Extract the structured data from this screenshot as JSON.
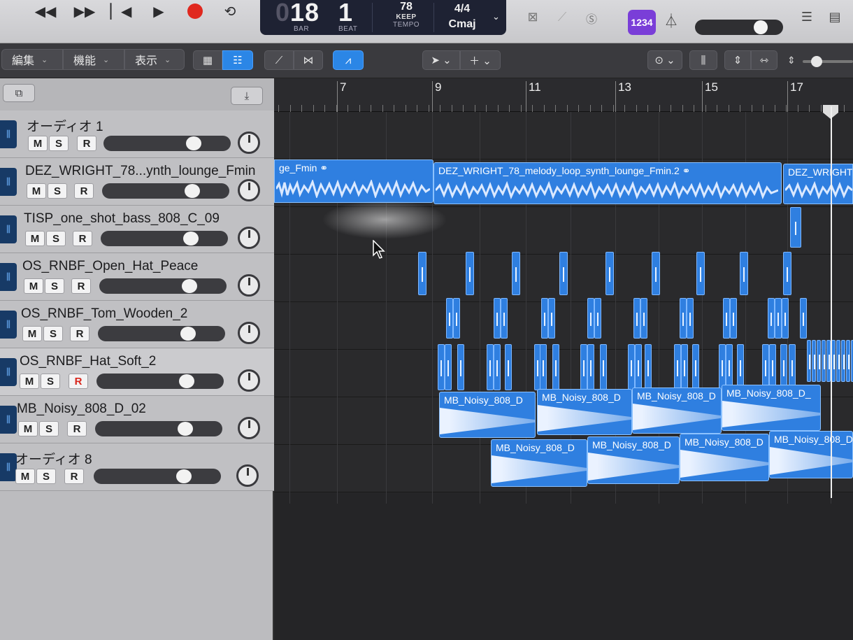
{
  "transport": {
    "lcd": {
      "bar_value": "18",
      "bar_label": "BAR",
      "bar_prefix": "0",
      "beat_value": "1",
      "beat_label": "BEAT",
      "tempo_value": "78",
      "tempo_mode": "KEEP",
      "tempo_label": "TEMPO",
      "time_signature": "4/4",
      "key": "Cmaj"
    },
    "count_in": "1234"
  },
  "toolbar": {
    "edit": "編集",
    "functions": "機能",
    "view": "表示"
  },
  "ruler": {
    "bars": [
      "7",
      "9",
      "11",
      "13",
      "15",
      "17"
    ]
  },
  "tracks": [
    {
      "name": "オーディオ 1",
      "mute": "M",
      "solo": "S",
      "rec": "R"
    },
    {
      "name": "DEZ_WRIGHT_78...ynth_lounge_Fmin",
      "mute": "M",
      "solo": "S",
      "rec": "R"
    },
    {
      "name": "TISP_one_shot_bass_808_C_09",
      "mute": "M",
      "solo": "S",
      "rec": "R"
    },
    {
      "name": "OS_RNBF_Open_Hat_Peace",
      "mute": "M",
      "solo": "S",
      "rec": "R"
    },
    {
      "name": "OS_RNBF_Tom_Wooden_2",
      "mute": "M",
      "solo": "S",
      "rec": "R"
    },
    {
      "name": "OS_RNBF_Hat_Soft_2",
      "mute": "M",
      "solo": "S",
      "rec": "R"
    },
    {
      "name": "MB_Noisy_808_D_02",
      "mute": "M",
      "solo": "S",
      "rec": "R"
    },
    {
      "name": "オーディオ 8",
      "mute": "M",
      "solo": "S",
      "rec": "R"
    }
  ],
  "regions": {
    "melody_a": "ge_Fmin",
    "melody_b": "DEZ_WRIGHT_78_melody_loop_synth_lounge_Fmin.2",
    "melody_c": "DEZ_WRIGHT",
    "noisy": [
      "MB_Noisy_808_D",
      "MB_Noisy_808_D",
      "MB_Noisy_808_D",
      "MB_Noisy_808_D_"
    ],
    "noisy2": [
      "MB_Noisy_808_D",
      "MB_Noisy_808_D",
      "MB_Noisy_808_D",
      "MB_Noisy_808_D"
    ]
  },
  "colors": {
    "region": "#2f7fe0",
    "count_in": "#7a3ed8",
    "record": "#e0281e",
    "active_tool": "#2b86e6"
  },
  "icons": [
    "rewind-icon",
    "fast-forward-icon",
    "go-to-start-icon",
    "play-icon",
    "record-icon",
    "cycle-icon",
    "metronome-icon",
    "list-icon",
    "notepad-icon"
  ]
}
